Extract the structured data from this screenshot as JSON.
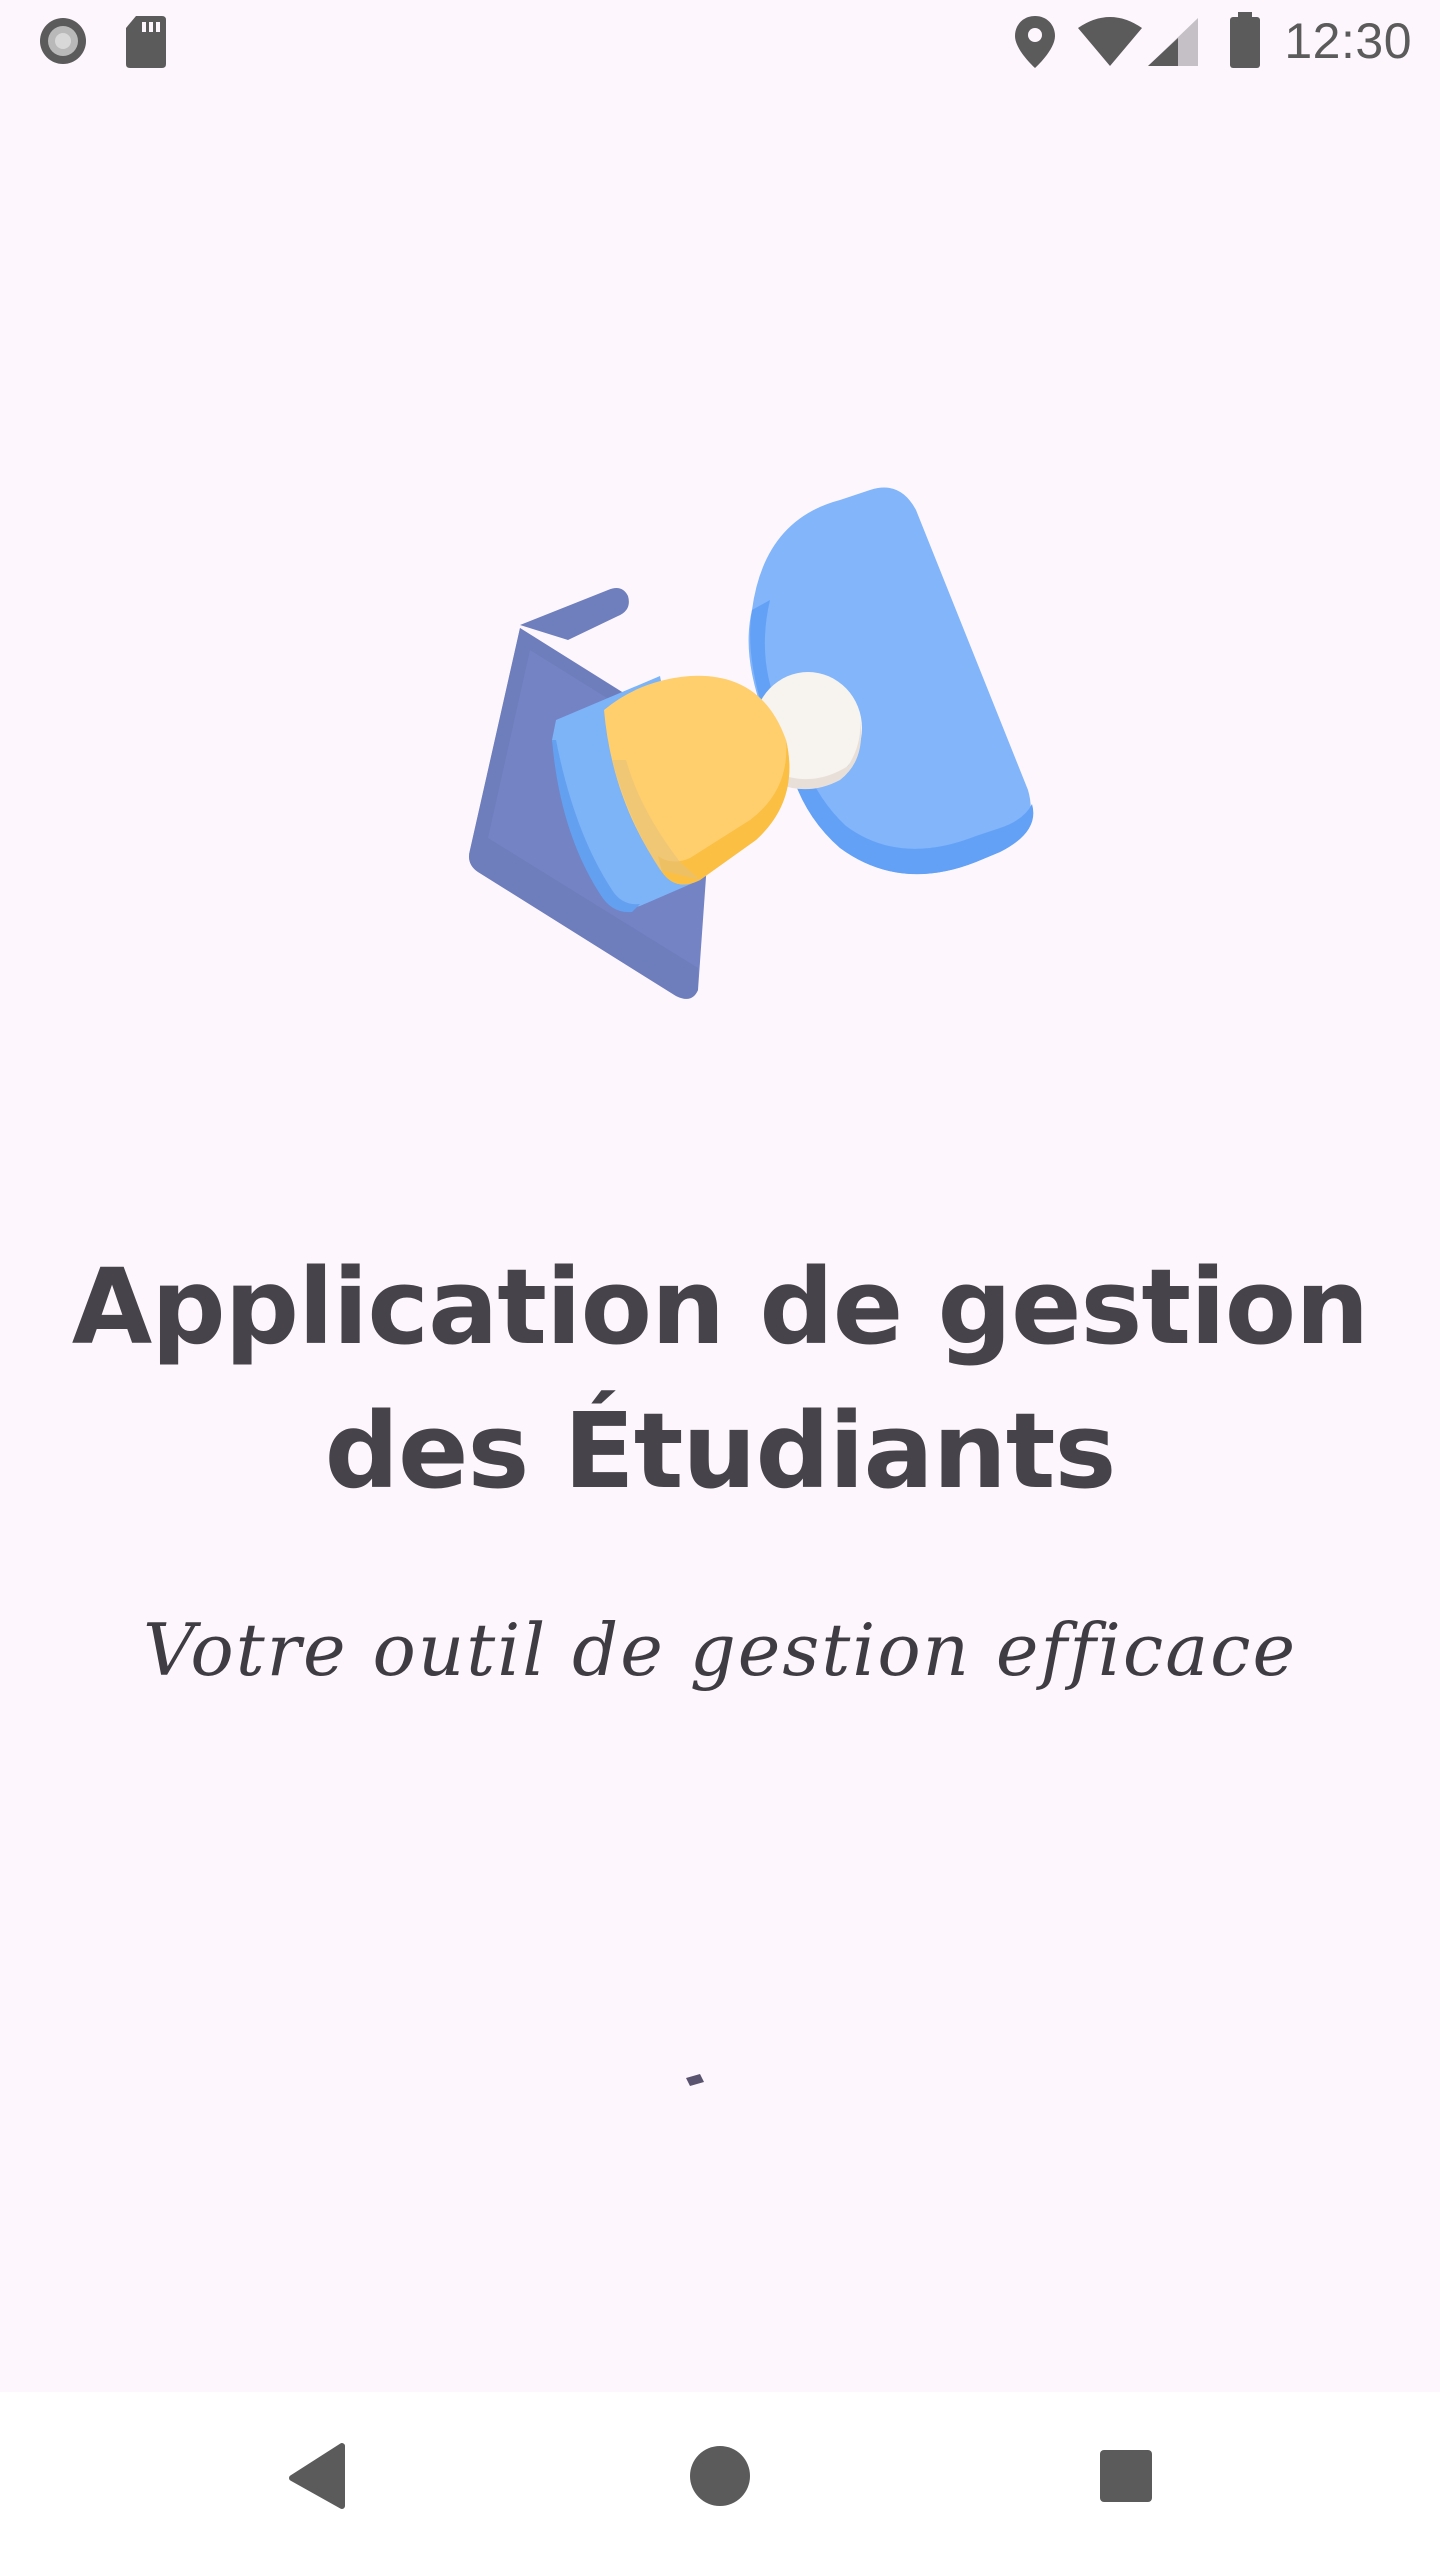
{
  "status_bar": {
    "time": "12:30"
  },
  "splash": {
    "title": "Application de gestion des Étudiants",
    "subtitle": "Votre outil de gestion efficace"
  },
  "icons": {
    "status_left": [
      "record-icon",
      "sd-card-icon"
    ],
    "status_right": [
      "location-icon",
      "wifi-icon",
      "cell-signal-icon",
      "battery-icon"
    ],
    "nav": [
      "back-icon",
      "home-icon",
      "recents-icon"
    ]
  },
  "colors": {
    "background": "#fdf7fd",
    "title_text": "#46434b",
    "nav_bar": "#ffffff",
    "system_icon": "#5b5b5b"
  }
}
